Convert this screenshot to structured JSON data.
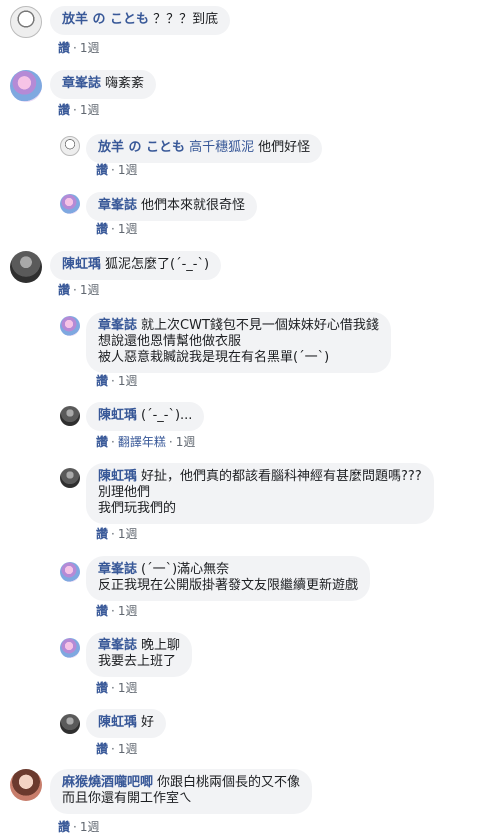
{
  "common": {
    "like": "讚",
    "time": "1週",
    "sep": "·",
    "translate": "翻譯年糕"
  },
  "comments": [
    {
      "author": "放羊 の ことも",
      "lines": [
        "？？？到底"
      ]
    },
    {
      "author": "章峯誌",
      "lines": [
        "嗨紊紊"
      ]
    },
    {
      "author": "放羊 の ことも",
      "tag": "高千穗狐泥",
      "lines": [
        "他們好怪"
      ]
    },
    {
      "author": "章峯誌",
      "lines": [
        "他們本來就很奇怪"
      ]
    },
    {
      "author": "陳虹瑀",
      "lines": [
        "狐泥怎麼了(´-_-`)"
      ]
    },
    {
      "author": "章峯誌",
      "lines": [
        "就上次CWT錢包不見一個妹妹好心借我錢",
        "想說還他恩情幫他做衣服",
        "被人惡意栽贓說我是現在有名黑單(´一`)"
      ]
    },
    {
      "author": "陳虹瑀",
      "lines": [
        "(´-_-`)..."
      ]
    },
    {
      "author": "陳虹瑀",
      "lines": [
        "好扯，他們真的都該看腦科神經有甚麼問題嗎???",
        "別理他們",
        "我們玩我們的"
      ]
    },
    {
      "author": "章峯誌",
      "lines": [
        "(´一`)滿心無奈",
        "反正我現在公開版掛著發文友限繼續更新遊戲"
      ]
    },
    {
      "author": "章峯誌",
      "lines": [
        "晚上聊",
        "我要去上班了"
      ]
    },
    {
      "author": "陳虹瑀",
      "lines": [
        "好"
      ]
    },
    {
      "author": "麻猴燒酒嚨吧唧",
      "lines": [
        "你跟白桃兩個長的又不像",
        "而且你還有開工作室ㄟ"
      ]
    }
  ]
}
